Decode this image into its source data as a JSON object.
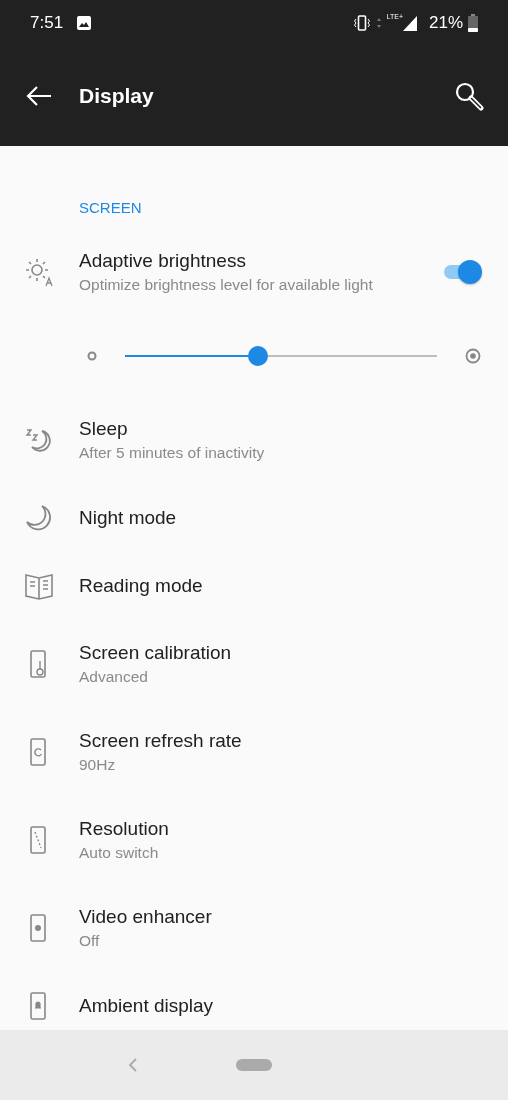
{
  "status_bar": {
    "time": "7:51",
    "network": "LTE+",
    "battery": "21%"
  },
  "toolbar": {
    "title": "Display"
  },
  "section": {
    "title": "SCREEN"
  },
  "items": [
    {
      "kind": "toggle",
      "title": "Adaptive brightness",
      "subtitle": "Optimize brightness level for available light",
      "on": true
    },
    {
      "kind": "slider",
      "level": 0.4
    },
    {
      "kind": "plain",
      "title": "Sleep",
      "subtitle": "After 5 minutes of inactivity"
    },
    {
      "kind": "plain",
      "title": "Night mode"
    },
    {
      "kind": "plain",
      "title": "Reading mode"
    },
    {
      "kind": "plain",
      "title": "Screen calibration",
      "subtitle": "Advanced"
    },
    {
      "kind": "plain",
      "title": "Screen refresh rate",
      "subtitle": "90Hz"
    },
    {
      "kind": "plain",
      "title": "Resolution",
      "subtitle": "Auto switch"
    },
    {
      "kind": "plain",
      "title": "Video enhancer",
      "subtitle": "Off"
    },
    {
      "kind": "plain",
      "title": "Ambient display"
    }
  ]
}
